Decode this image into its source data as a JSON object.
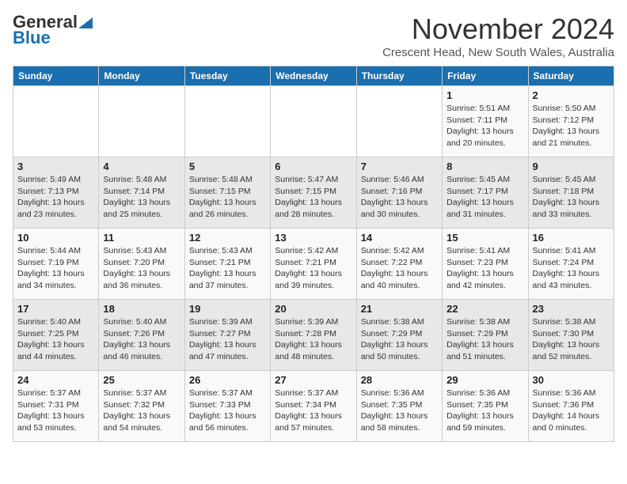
{
  "header": {
    "logo_general": "General",
    "logo_blue": "Blue",
    "month": "November 2024",
    "location": "Crescent Head, New South Wales, Australia"
  },
  "weekdays": [
    "Sunday",
    "Monday",
    "Tuesday",
    "Wednesday",
    "Thursday",
    "Friday",
    "Saturday"
  ],
  "weeks": [
    [
      {
        "day": "",
        "info": ""
      },
      {
        "day": "",
        "info": ""
      },
      {
        "day": "",
        "info": ""
      },
      {
        "day": "",
        "info": ""
      },
      {
        "day": "",
        "info": ""
      },
      {
        "day": "1",
        "info": "Sunrise: 5:51 AM\nSunset: 7:11 PM\nDaylight: 13 hours\nand 20 minutes."
      },
      {
        "day": "2",
        "info": "Sunrise: 5:50 AM\nSunset: 7:12 PM\nDaylight: 13 hours\nand 21 minutes."
      }
    ],
    [
      {
        "day": "3",
        "info": "Sunrise: 5:49 AM\nSunset: 7:13 PM\nDaylight: 13 hours\nand 23 minutes."
      },
      {
        "day": "4",
        "info": "Sunrise: 5:48 AM\nSunset: 7:14 PM\nDaylight: 13 hours\nand 25 minutes."
      },
      {
        "day": "5",
        "info": "Sunrise: 5:48 AM\nSunset: 7:15 PM\nDaylight: 13 hours\nand 26 minutes."
      },
      {
        "day": "6",
        "info": "Sunrise: 5:47 AM\nSunset: 7:15 PM\nDaylight: 13 hours\nand 28 minutes."
      },
      {
        "day": "7",
        "info": "Sunrise: 5:46 AM\nSunset: 7:16 PM\nDaylight: 13 hours\nand 30 minutes."
      },
      {
        "day": "8",
        "info": "Sunrise: 5:45 AM\nSunset: 7:17 PM\nDaylight: 13 hours\nand 31 minutes."
      },
      {
        "day": "9",
        "info": "Sunrise: 5:45 AM\nSunset: 7:18 PM\nDaylight: 13 hours\nand 33 minutes."
      }
    ],
    [
      {
        "day": "10",
        "info": "Sunrise: 5:44 AM\nSunset: 7:19 PM\nDaylight: 13 hours\nand 34 minutes."
      },
      {
        "day": "11",
        "info": "Sunrise: 5:43 AM\nSunset: 7:20 PM\nDaylight: 13 hours\nand 36 minutes."
      },
      {
        "day": "12",
        "info": "Sunrise: 5:43 AM\nSunset: 7:21 PM\nDaylight: 13 hours\nand 37 minutes."
      },
      {
        "day": "13",
        "info": "Sunrise: 5:42 AM\nSunset: 7:21 PM\nDaylight: 13 hours\nand 39 minutes."
      },
      {
        "day": "14",
        "info": "Sunrise: 5:42 AM\nSunset: 7:22 PM\nDaylight: 13 hours\nand 40 minutes."
      },
      {
        "day": "15",
        "info": "Sunrise: 5:41 AM\nSunset: 7:23 PM\nDaylight: 13 hours\nand 42 minutes."
      },
      {
        "day": "16",
        "info": "Sunrise: 5:41 AM\nSunset: 7:24 PM\nDaylight: 13 hours\nand 43 minutes."
      }
    ],
    [
      {
        "day": "17",
        "info": "Sunrise: 5:40 AM\nSunset: 7:25 PM\nDaylight: 13 hours\nand 44 minutes."
      },
      {
        "day": "18",
        "info": "Sunrise: 5:40 AM\nSunset: 7:26 PM\nDaylight: 13 hours\nand 46 minutes."
      },
      {
        "day": "19",
        "info": "Sunrise: 5:39 AM\nSunset: 7:27 PM\nDaylight: 13 hours\nand 47 minutes."
      },
      {
        "day": "20",
        "info": "Sunrise: 5:39 AM\nSunset: 7:28 PM\nDaylight: 13 hours\nand 48 minutes."
      },
      {
        "day": "21",
        "info": "Sunrise: 5:38 AM\nSunset: 7:29 PM\nDaylight: 13 hours\nand 50 minutes."
      },
      {
        "day": "22",
        "info": "Sunrise: 5:38 AM\nSunset: 7:29 PM\nDaylight: 13 hours\nand 51 minutes."
      },
      {
        "day": "23",
        "info": "Sunrise: 5:38 AM\nSunset: 7:30 PM\nDaylight: 13 hours\nand 52 minutes."
      }
    ],
    [
      {
        "day": "24",
        "info": "Sunrise: 5:37 AM\nSunset: 7:31 PM\nDaylight: 13 hours\nand 53 minutes."
      },
      {
        "day": "25",
        "info": "Sunrise: 5:37 AM\nSunset: 7:32 PM\nDaylight: 13 hours\nand 54 minutes."
      },
      {
        "day": "26",
        "info": "Sunrise: 5:37 AM\nSunset: 7:33 PM\nDaylight: 13 hours\nand 56 minutes."
      },
      {
        "day": "27",
        "info": "Sunrise: 5:37 AM\nSunset: 7:34 PM\nDaylight: 13 hours\nand 57 minutes."
      },
      {
        "day": "28",
        "info": "Sunrise: 5:36 AM\nSunset: 7:35 PM\nDaylight: 13 hours\nand 58 minutes."
      },
      {
        "day": "29",
        "info": "Sunrise: 5:36 AM\nSunset: 7:35 PM\nDaylight: 13 hours\nand 59 minutes."
      },
      {
        "day": "30",
        "info": "Sunrise: 5:36 AM\nSunset: 7:36 PM\nDaylight: 14 hours\nand 0 minutes."
      }
    ]
  ]
}
